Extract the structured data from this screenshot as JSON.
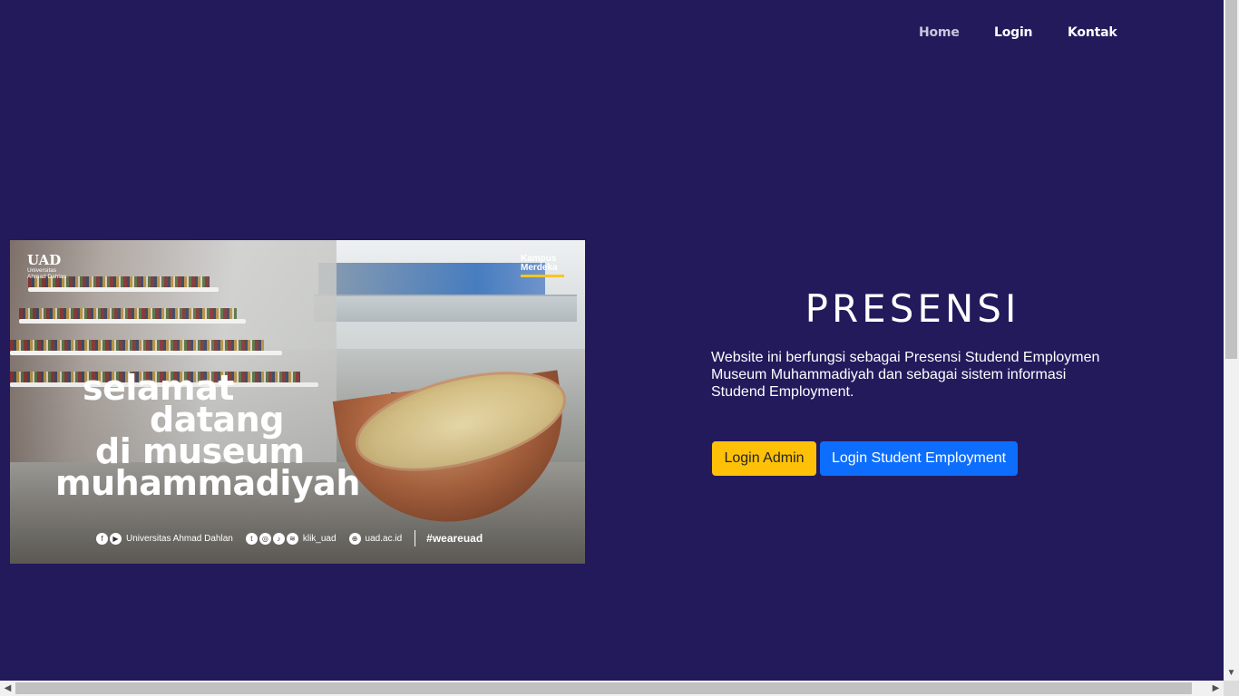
{
  "nav": {
    "items": [
      {
        "label": "Home",
        "active": true
      },
      {
        "label": "Login",
        "active": false
      },
      {
        "label": "Kontak",
        "active": false
      }
    ]
  },
  "hero_image": {
    "brand_short": "UAD",
    "brand_full_line1": "Universitas",
    "brand_full_line2": "Ahmad Dahlan",
    "campaign_line1": "Kampus",
    "campaign_line2": "Merdeka",
    "headline": [
      "selamat",
      "datang",
      "di museum",
      "muhammadiyah"
    ],
    "footer": {
      "facebook_youtube": "Universitas Ahmad Dahlan",
      "socials": "klik_uad",
      "website": "uad.ac.id",
      "hashtag": "#weareuad"
    }
  },
  "main": {
    "title": "PRESENSI",
    "description": "Website ini berfungsi sebagai Presensi Studend Employmen Museum Muhammadiyah dan sebagai sistem informasi Studend Employment.",
    "buttons": {
      "admin": "Login Admin",
      "student": "Login Student Employment"
    }
  },
  "colors": {
    "background": "#231a5c",
    "admin_button": "#ffc107",
    "student_button": "#0d6efd"
  },
  "icons": {
    "scroll_up": "chevron-up-icon",
    "scroll_down": "chevron-down-icon",
    "scroll_left": "chevron-left-icon",
    "scroll_right": "chevron-right-icon"
  }
}
